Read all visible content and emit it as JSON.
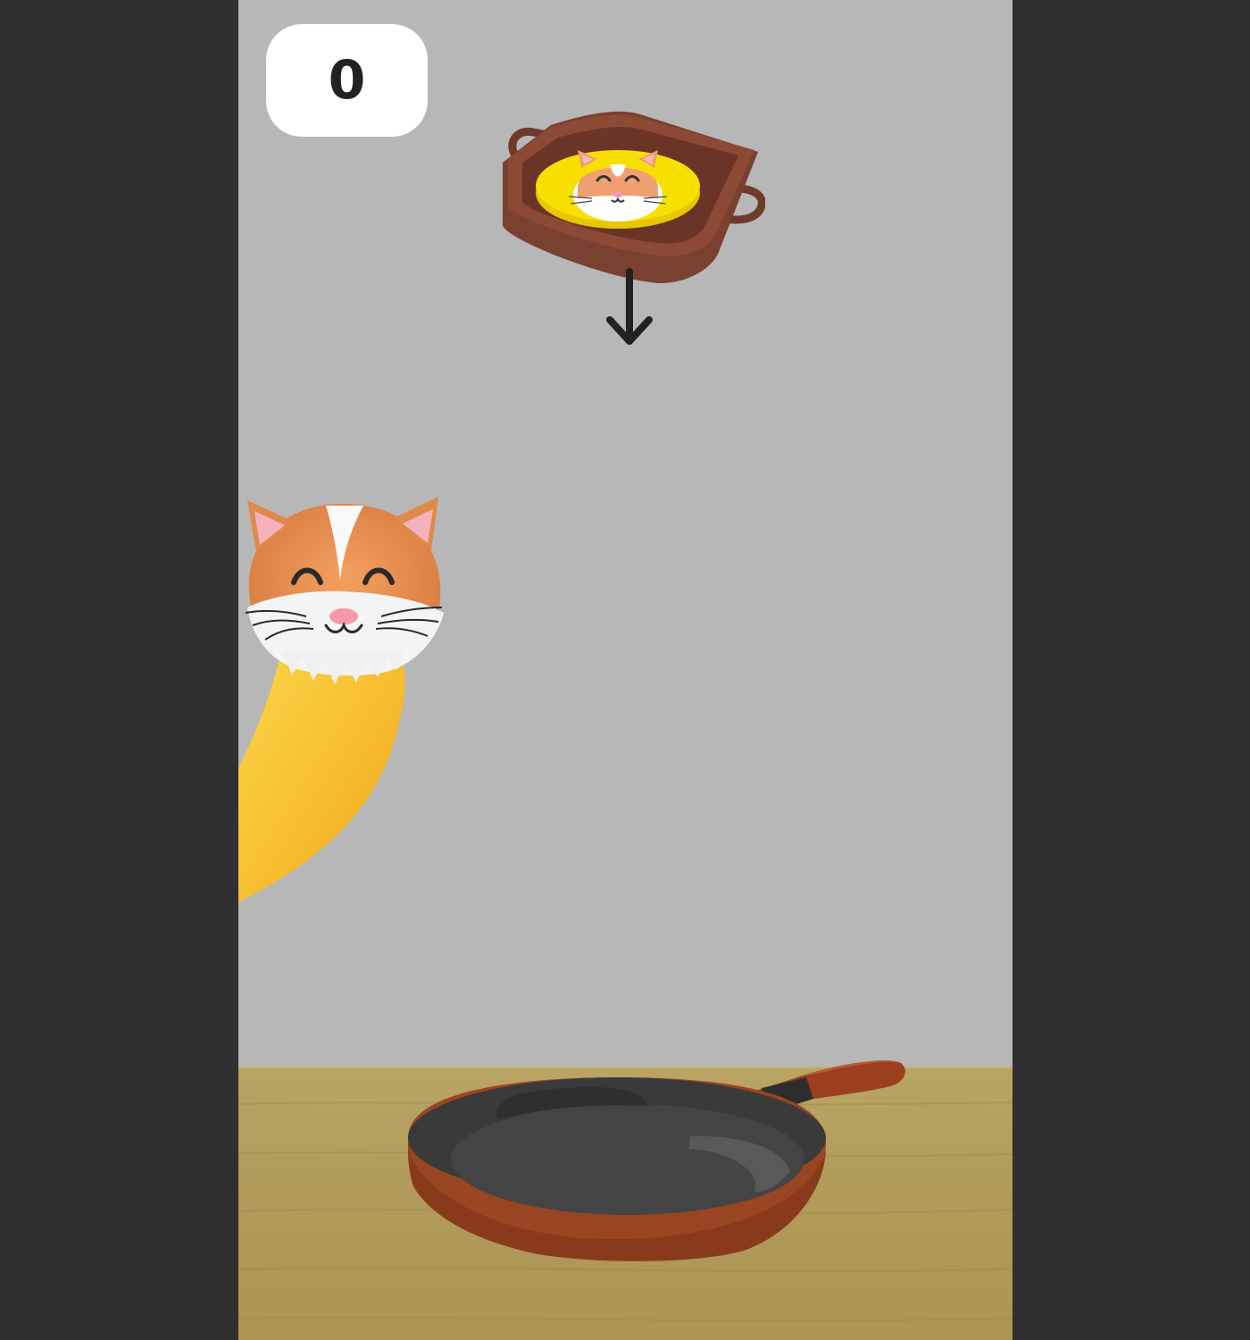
{
  "hud": {
    "score": "0"
  },
  "icons": {
    "score_panel": "score-panel",
    "tray": "brown-tray-icon",
    "pancake": "cat-pancake-icon",
    "drop_arrow": "arrow-down-icon",
    "character": "cat-banana-character",
    "frying_pan": "frying-pan-icon"
  },
  "colors": {
    "side_bars": "#303030",
    "wall": "#b7b7b7",
    "table": "#b29c5b",
    "tray": "#7a4030",
    "pancake": "#f7e000",
    "pan_body": "#3a3a3a",
    "pan_rim": "#9a4522",
    "banana": "#f8c230",
    "cat_fur": "#e48b4e"
  }
}
